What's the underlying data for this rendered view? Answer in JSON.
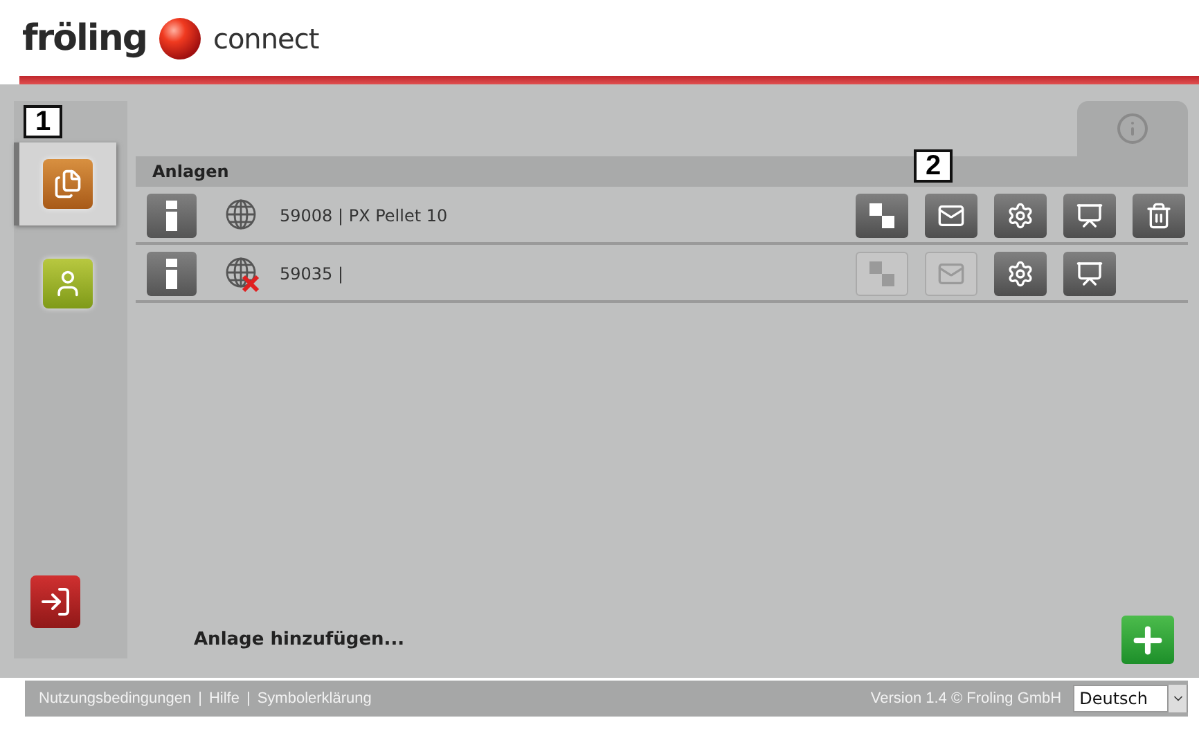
{
  "logo": {
    "brand": "fröling",
    "product": "connect"
  },
  "callouts": [
    "1",
    "2"
  ],
  "sidebar": {
    "items": [
      {
        "kind": "plants",
        "selected": true
      },
      {
        "kind": "user",
        "selected": false
      }
    ],
    "logout": {
      "kind": "logout"
    }
  },
  "info_tab": {
    "selected": true
  },
  "panel": {
    "title": "Anlagen",
    "rows": [
      {
        "label": "59008 | PX Pellet 10",
        "online": true,
        "actions": [
          {
            "kind": "network",
            "disabled": false
          },
          {
            "kind": "mail",
            "disabled": false
          },
          {
            "kind": "settings",
            "disabled": false
          },
          {
            "kind": "view",
            "disabled": false
          },
          {
            "kind": "delete",
            "disabled": false
          }
        ]
      },
      {
        "label": "59035 |",
        "online": false,
        "actions": [
          {
            "kind": "network",
            "disabled": true
          },
          {
            "kind": "mail",
            "disabled": true
          },
          {
            "kind": "settings",
            "disabled": false
          },
          {
            "kind": "view",
            "disabled": false
          }
        ]
      }
    ]
  },
  "add_label": "Anlage hinzufügen...",
  "footer": {
    "links": [
      "Nutzungsbedingungen",
      "Hilfe",
      "Symbolerklärung"
    ],
    "separator": "|",
    "version": "Version 1.4 © Froling GmbH",
    "language": "Deutsch"
  }
}
